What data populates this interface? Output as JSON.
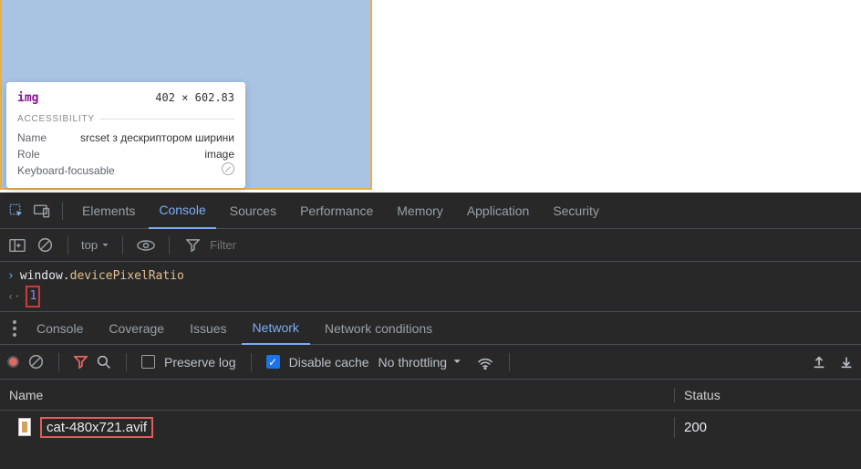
{
  "tooltip": {
    "tag": "img",
    "dimensions": "402 × 602.83",
    "section": "ACCESSIBILITY",
    "name_label": "Name",
    "name_value": "srcset з дескриптором ширини",
    "role_label": "Role",
    "role_value": "image",
    "kf_label": "Keyboard-focusable"
  },
  "tabs": {
    "elements": "Elements",
    "console": "Console",
    "sources": "Sources",
    "performance": "Performance",
    "memory": "Memory",
    "application": "Application",
    "security": "Security"
  },
  "subbar": {
    "top": "top",
    "filter_placeholder": "Filter"
  },
  "console": {
    "obj": "window",
    "prop": "devicePixelRatio",
    "result": "1"
  },
  "drawer": {
    "console": "Console",
    "coverage": "Coverage",
    "issues": "Issues",
    "network": "Network",
    "netcond": "Network conditions"
  },
  "network": {
    "preserve": "Preserve log",
    "disable": "Disable cache",
    "throttle": "No throttling",
    "col_name": "Name",
    "col_status": "Status",
    "file": "cat-480x721.avif",
    "status": "200"
  }
}
